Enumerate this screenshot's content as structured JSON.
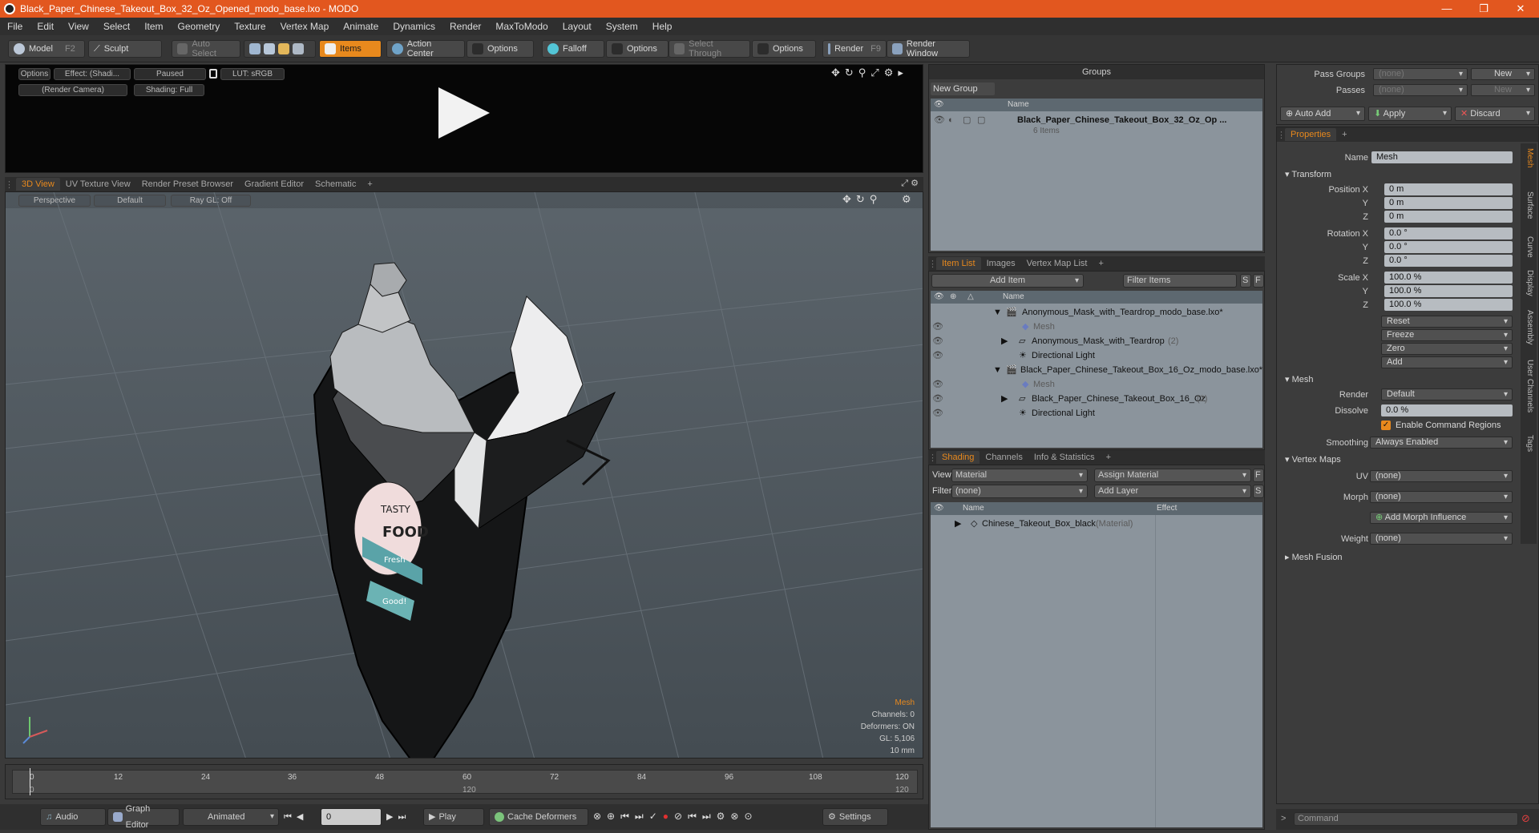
{
  "window": {
    "title": "Black_Paper_Chinese_Takeout_Box_32_Oz_Opened_modo_base.lxo - MODO",
    "minimize": "—",
    "maximize": "❐",
    "close": "✕"
  },
  "menu": [
    "File",
    "Edit",
    "View",
    "Select",
    "Item",
    "Geometry",
    "Texture",
    "Vertex Map",
    "Animate",
    "Dynamics",
    "Render",
    "MaxToModo",
    "Layout",
    "System",
    "Help"
  ],
  "toolbar": {
    "model": "Model",
    "model_key": "F2",
    "sculpt": "Sculpt",
    "auto_select": "Auto Select",
    "items": "Items",
    "action_center": "Action Center",
    "options1": "Options",
    "falloff": "Falloff",
    "options2": "Options",
    "select_through": "Select Through",
    "options3": "Options",
    "render": "Render",
    "render_key": "F9",
    "render_window": "Render Window"
  },
  "preview": {
    "options": "Options",
    "effect": "Effect: (Shadi...",
    "paused": "Paused",
    "lut": "LUT: sRGB",
    "camera": "(Render Camera)",
    "shading": "Shading: Full"
  },
  "viewport_tabs": [
    "3D View",
    "UV Texture View",
    "Render Preset Browser",
    "Gradient Editor",
    "Schematic",
    "+"
  ],
  "viewport": {
    "perspective": "Perspective",
    "default": "Default",
    "raygl": "Ray GL: Off",
    "info_title": "Mesh",
    "info_lines": [
      "Channels: 0",
      "Deformers: ON",
      "GL: 5,106",
      "10 mm"
    ],
    "label_text": [
      "TASTY",
      "FOOD",
      "Fresh",
      "Good!"
    ]
  },
  "timeline": {
    "ticks": [
      "0",
      "12",
      "24",
      "36",
      "48",
      "60",
      "72",
      "84",
      "96",
      "108",
      "120"
    ],
    "lower_ticks": [
      "0",
      "120",
      "120"
    ]
  },
  "bottombar": {
    "audio": "Audio",
    "graph_editor": "Graph Editor",
    "animated": "Animated",
    "frame": "0",
    "play": "Play",
    "cache_deformers": "Cache Deformers",
    "settings": "Settings"
  },
  "groups": {
    "header": "Groups",
    "new_group": "New Group",
    "col_name": "Name",
    "item_name": "Black_Paper_Chinese_Takeout_Box_32_Oz_Op ...",
    "item_sub": "6 Items"
  },
  "itemlist": {
    "tabs": [
      "Item List",
      "Images",
      "Vertex Map List",
      "+"
    ],
    "add_item": "Add Item",
    "filter": "Filter Items",
    "s": "S",
    "f": "F",
    "col_name": "Name",
    "rows": [
      {
        "text": "Anonymous_Mask_with_Teardrop_modo_base.lxo*",
        "extra": ""
      },
      {
        "text": "Mesh",
        "extra": ""
      },
      {
        "text": "Anonymous_Mask_with_Teardrop",
        "extra": "(2)"
      },
      {
        "text": "Directional Light",
        "extra": ""
      },
      {
        "text": "Black_Paper_Chinese_Takeout_Box_16_Oz_modo_base.lxo*",
        "extra": ""
      },
      {
        "text": "Mesh",
        "extra": ""
      },
      {
        "text": "Black_Paper_Chinese_Takeout_Box_16_Oz",
        "extra": "(2)"
      },
      {
        "text": "Directional Light",
        "extra": ""
      }
    ]
  },
  "shading": {
    "tabs": [
      "Shading",
      "Channels",
      "Info & Statistics",
      "+"
    ],
    "view_label": "View",
    "view_value": "Material",
    "assign_material": "Assign Material",
    "filter_label": "Filter",
    "filter_value": "(none)",
    "add_layer": "Add Layer",
    "f": "F",
    "s": "S",
    "col_name": "Name",
    "col_effect": "Effect",
    "row_name": "Chinese_Takeout_Box_black",
    "row_type": "(Material)"
  },
  "passes": {
    "pass_groups": "Pass Groups",
    "pass_groups_val": "(none)",
    "new": "New",
    "passes": "Passes",
    "passes_val": "(none)",
    "new2": "New",
    "auto_add": "Auto Add",
    "apply": "Apply",
    "discard": "Discard"
  },
  "properties": {
    "tab": "Properties",
    "plus": "+",
    "name_label": "Name",
    "name_value": "Mesh",
    "transform": "Transform",
    "position_x_label": "Position X",
    "y_label": "Y",
    "z_label": "Z",
    "position": [
      "0 m",
      "0 m",
      "0 m"
    ],
    "rotation_x_label": "Rotation X",
    "rotation": [
      "0.0 °",
      "0.0 °",
      "0.0 °"
    ],
    "scale_x_label": "Scale X",
    "scale": [
      "100.0 %",
      "100.0 %",
      "100.0 %"
    ],
    "reset": "Reset",
    "freeze": "Freeze",
    "zero": "Zero",
    "add": "Add",
    "mesh": "Mesh",
    "render_label": "Render",
    "render_value": "Default",
    "dissolve_label": "Dissolve",
    "dissolve_value": "0.0 %",
    "enable_cmd": "Enable Command Regions",
    "smoothing_label": "Smoothing",
    "smoothing_value": "Always Enabled",
    "vertex_maps": "Vertex Maps",
    "uv_label": "UV",
    "uv_value": "(none)",
    "morph_label": "Morph",
    "morph_value": "(none)",
    "add_morph": "Add Morph Influence",
    "weight_label": "Weight",
    "weight_value": "(none)",
    "mesh_fusion": "Mesh Fusion",
    "vtabs": [
      "Mesh",
      "Surface",
      "Curve",
      "Display",
      "Assembly",
      "User Channels",
      "Tags"
    ],
    "command": "Command"
  },
  "colors": {
    "accent": "#e8891d",
    "titlebar": "#e2571f"
  }
}
